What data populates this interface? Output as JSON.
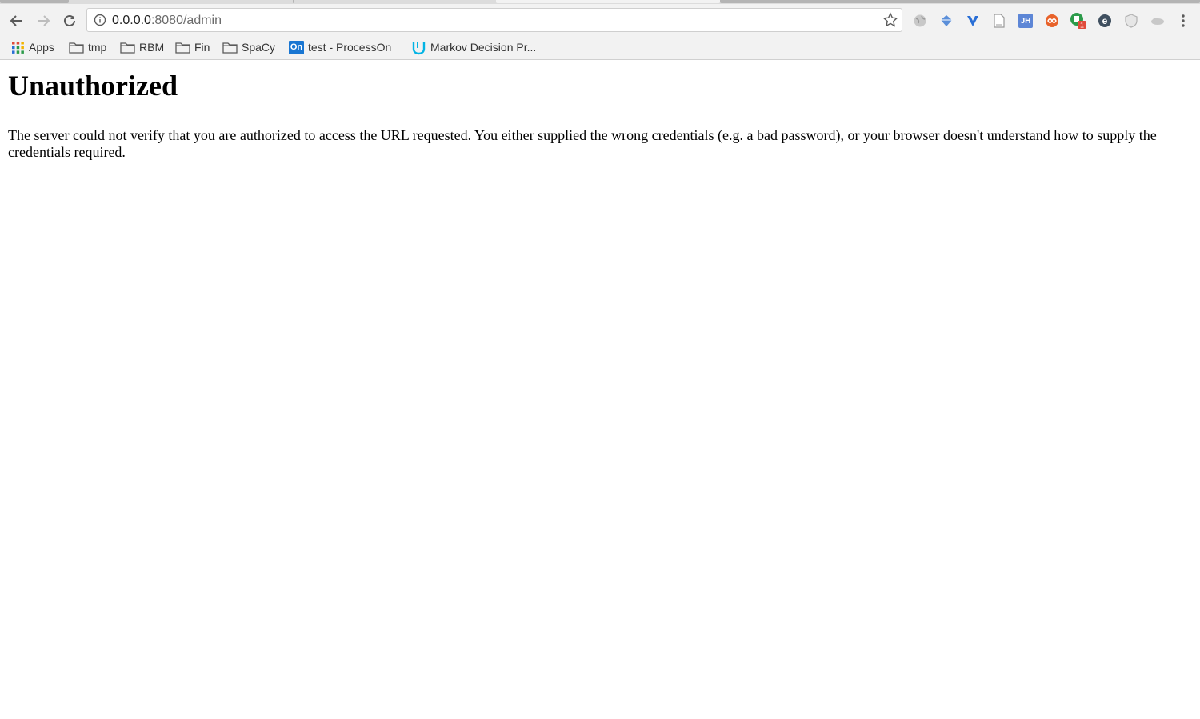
{
  "browser": {
    "url_host": "0.0.0.0",
    "url_rest": ":8080/admin",
    "bookmarks": [
      {
        "label": "Apps",
        "icon": "apps-grid-icon"
      },
      {
        "label": "tmp",
        "icon": "folder-icon"
      },
      {
        "label": "RBM",
        "icon": "folder-icon"
      },
      {
        "label": "Fin",
        "icon": "folder-icon"
      },
      {
        "label": "SpaCy",
        "icon": "folder-icon"
      },
      {
        "label": "test - ProcessOn",
        "icon": "processon-icon"
      },
      {
        "label": "Markov Decision Pr...",
        "icon": "udacity-icon"
      }
    ],
    "extensions": [
      "globe-extension-icon",
      "diamond-extension-icon",
      "v-extension-icon",
      "page-extension-icon",
      "jh-extension-icon",
      "infinity-extension-icon",
      "green-extension-icon",
      "e-extension-icon",
      "shield-extension-icon",
      "cloud-extension-icon"
    ],
    "extension_texts": {
      "jh": "JH",
      "badge": "1",
      "e": "e",
      "processon": "On"
    }
  },
  "page": {
    "title": "Unauthorized",
    "message": "The server could not verify that you are authorized to access the URL requested. You either supplied the wrong credentials (e.g. a bad password), or your browser doesn't understand how to supply the credentials required."
  },
  "colors": {
    "chrome_bg": "#f2f2f2",
    "page_bg": "#ffffff",
    "text": "#000000"
  }
}
